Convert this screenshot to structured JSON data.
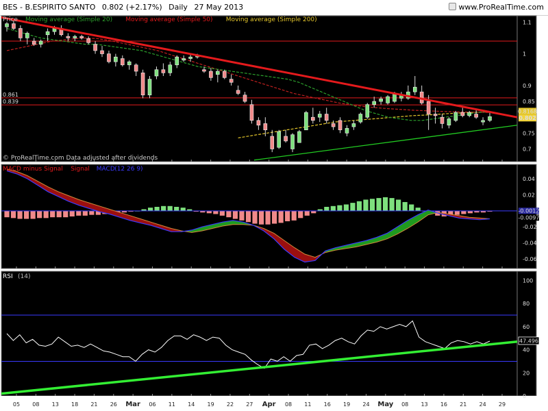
{
  "header": {
    "ticker": "BES - B.ESPIRITO SANTO",
    "price": "0.802 (+2.17%)",
    "period": "Daily",
    "date": "27 May 2013",
    "site": "www.ProRealTime.com"
  },
  "price_panel": {
    "legend": [
      {
        "text": "Price",
        "color": "#c8c8c8"
      },
      {
        "text": "Moving average (Simple 20)",
        "color": "#2ca02c"
      },
      {
        "text": "Moving average (Simple 50)",
        "color": "#e41a1c"
      },
      {
        "text": "Moving average (Simple 200)",
        "color": "#e6c82c"
      }
    ],
    "watermark": "© ProRealTime.com  Data adjusted after dividends",
    "level_labels": [
      {
        "text": "0.861",
        "value": 0.861
      },
      {
        "text": "0.839",
        "value": 0.839
      }
    ],
    "last_label_ma": "0.8168",
    "last_label_price": "0.802"
  },
  "macd_panel": {
    "legend": [
      {
        "text": "MACD minus Signal",
        "color": "#e41a1c"
      },
      {
        "text": "Signal",
        "color": "#e41a1c"
      },
      {
        "text": "MACD",
        "color": "#3a3aff"
      },
      {
        "text": "(12 26 9)",
        "color": "#3a3aff"
      }
    ],
    "last_label_top": "-0.0012",
    "last_label_bottom": "-0.0097"
  },
  "rsi_panel": {
    "legend": [
      {
        "text": "RSI",
        "color": "#ffffff"
      },
      {
        "text": "(14)",
        "color": "#bbbbbb"
      }
    ],
    "last_label": "47.496"
  },
  "chart_data": [
    {
      "type": "candlestick",
      "title": "BES - B.ESPIRITO SANTO",
      "ylim": [
        0.66,
        1.12
      ],
      "yticks": [
        0.7,
        0.75,
        0.8,
        0.85,
        0.9,
        1,
        1.1
      ],
      "ytick_labels": [
        "0.7",
        "0.75",
        "0.8",
        "0.85",
        "0.9",
        "1",
        "1.1"
      ],
      "x_ticks": [
        "05",
        "08",
        "13",
        "18",
        "21",
        "26",
        "Mar",
        "06",
        "11",
        "14",
        "19",
        "22",
        "27",
        "Apr",
        "08",
        "11",
        "16",
        "19",
        "24",
        "May",
        "08",
        "13",
        "16",
        "21",
        "24",
        "29"
      ],
      "ohlc": [
        [
          1.085,
          1.1,
          1.07,
          1.095
        ],
        [
          1.095,
          1.108,
          1.075,
          1.08
        ],
        [
          1.08,
          1.09,
          1.04,
          1.05
        ],
        [
          1.05,
          1.07,
          1.03,
          1.065
        ],
        [
          1.04,
          1.05,
          1.025,
          1.03
        ],
        [
          1.03,
          1.045,
          1.02,
          1.04
        ],
        [
          1.06,
          1.08,
          1.04,
          1.07
        ],
        [
          1.07,
          1.088,
          1.06,
          1.08
        ],
        [
          1.08,
          1.09,
          1.055,
          1.06
        ],
        [
          1.055,
          1.065,
          1.04,
          1.05
        ],
        [
          1.05,
          1.06,
          1.04,
          1.055
        ],
        [
          1.055,
          1.06,
          1.045,
          1.05
        ],
        [
          1.048,
          1.055,
          1.03,
          1.035
        ],
        [
          1.03,
          1.04,
          1.0,
          1.01
        ],
        [
          1.01,
          1.025,
          0.99,
          1.0
        ],
        [
          1.0,
          1.01,
          0.97,
          0.975
        ],
        [
          0.975,
          1.0,
          0.96,
          0.99
        ],
        [
          0.985,
          0.995,
          0.96,
          0.965
        ],
        [
          0.965,
          0.98,
          0.95,
          0.975
        ],
        [
          0.965,
          0.97,
          0.93,
          0.945
        ],
        [
          0.94,
          0.95,
          0.86,
          0.87
        ],
        [
          0.87,
          0.93,
          0.86,
          0.92
        ],
        [
          0.93,
          0.96,
          0.92,
          0.95
        ],
        [
          0.95,
          0.97,
          0.93,
          0.94
        ],
        [
          0.94,
          0.975,
          0.93,
          0.965
        ],
        [
          0.965,
          0.995,
          0.955,
          0.99
        ],
        [
          0.98,
          0.995,
          0.975,
          0.985
        ],
        [
          0.985,
          1.0,
          0.975,
          0.99
        ],
        [
          0.99,
          1.0,
          0.985,
          0.995
        ],
        [
          0.95,
          0.96,
          0.94,
          0.945
        ],
        [
          0.945,
          0.955,
          0.915,
          0.925
        ],
        [
          0.935,
          0.95,
          0.91,
          0.945
        ],
        [
          0.945,
          0.95,
          0.92,
          0.925
        ],
        [
          0.92,
          0.935,
          0.9,
          0.91
        ],
        [
          0.885,
          0.9,
          0.87,
          0.875
        ],
        [
          0.87,
          0.88,
          0.845,
          0.85
        ],
        [
          0.84,
          0.855,
          0.78,
          0.79
        ],
        [
          0.79,
          0.8,
          0.76,
          0.775
        ],
        [
          0.78,
          0.8,
          0.74,
          0.76
        ],
        [
          0.74,
          0.76,
          0.69,
          0.7
        ],
        [
          0.705,
          0.76,
          0.7,
          0.755
        ],
        [
          0.74,
          0.76,
          0.72,
          0.725
        ],
        [
          0.7,
          0.75,
          0.69,
          0.745
        ],
        [
          0.72,
          0.76,
          0.72,
          0.755
        ],
        [
          0.76,
          0.82,
          0.76,
          0.815
        ],
        [
          0.8,
          0.83,
          0.78,
          0.79
        ],
        [
          0.8,
          0.82,
          0.785,
          0.81
        ],
        [
          0.81,
          0.83,
          0.78,
          0.79
        ],
        [
          0.78,
          0.79,
          0.76,
          0.77
        ],
        [
          0.79,
          0.8,
          0.75,
          0.76
        ],
        [
          0.75,
          0.775,
          0.74,
          0.765
        ],
        [
          0.77,
          0.79,
          0.76,
          0.78
        ],
        [
          0.785,
          0.815,
          0.78,
          0.81
        ],
        [
          0.8,
          0.845,
          0.795,
          0.84
        ],
        [
          0.84,
          0.865,
          0.83,
          0.85
        ],
        [
          0.85,
          0.865,
          0.84,
          0.858
        ],
        [
          0.845,
          0.87,
          0.84,
          0.865
        ],
        [
          0.85,
          0.88,
          0.845,
          0.875
        ],
        [
          0.86,
          0.88,
          0.85,
          0.87
        ],
        [
          0.86,
          0.9,
          0.855,
          0.88
        ],
        [
          0.88,
          0.93,
          0.87,
          0.895
        ],
        [
          0.88,
          0.9,
          0.84,
          0.845
        ],
        [
          0.85,
          0.87,
          0.76,
          0.81
        ],
        [
          0.81,
          0.83,
          0.78,
          0.805
        ],
        [
          0.8,
          0.81,
          0.765,
          0.78
        ],
        [
          0.775,
          0.8,
          0.765,
          0.795
        ],
        [
          0.79,
          0.82,
          0.785,
          0.815
        ],
        [
          0.815,
          0.83,
          0.8,
          0.805
        ],
        [
          0.805,
          0.82,
          0.8,
          0.815
        ],
        [
          0.81,
          0.825,
          0.795,
          0.8
        ],
        [
          0.785,
          0.8,
          0.775,
          0.79
        ],
        [
          0.79,
          0.815,
          0.785,
          0.802
        ]
      ],
      "ma20": [
        1.08,
        1.07,
        1.06,
        1.05,
        1.045,
        1.04,
        1.035,
        1.03,
        1.03,
        1.025,
        1.02,
        1.015,
        1.01,
        1.0,
        0.99,
        0.98,
        0.97,
        0.96,
        0.955,
        0.95,
        0.945,
        0.94,
        0.935,
        0.93,
        0.925,
        0.92,
        0.91,
        0.895,
        0.88,
        0.865,
        0.85,
        0.835,
        0.82,
        0.81,
        0.8,
        0.795,
        0.79,
        0.79,
        0.795,
        0.8,
        0.805,
        0.81,
        0.815,
        0.818
      ],
      "ma50": [
        1.01,
        1.02,
        1.03,
        1.04,
        1.045,
        1.05,
        1.048,
        1.04,
        1.03,
        1.02,
        1.01,
        0.995,
        0.98,
        0.965,
        0.95,
        0.935,
        0.92,
        0.905,
        0.89,
        0.875,
        0.865,
        0.855,
        0.845,
        0.838,
        0.832,
        0.828,
        0.825,
        0.822,
        0.82,
        0.818,
        0.817,
        0.816,
        0.815
      ],
      "ma200": [
        0.735,
        0.745,
        0.755,
        0.765,
        0.775,
        0.785,
        0.79,
        0.795,
        0.8,
        0.805,
        0.808,
        0.812,
        0.815,
        0.817
      ],
      "trendlines": [
        {
          "from": [
            0,
            1.115
          ],
          "to": [
            1,
            0.8
          ],
          "color": "#e41a1c"
        },
        {
          "from": [
            0.49,
            0.665
          ],
          "to": [
            1,
            0.775
          ],
          "color": "#22cc22"
        }
      ],
      "horizontal_levels": [
        0.861,
        0.839,
        1.04
      ]
    },
    {
      "type": "bar",
      "title": "MACD minus Signal",
      "ylim": [
        -0.072,
        0.058
      ],
      "yticks": [
        0.04,
        0.02,
        0,
        -0.02,
        -0.04,
        -0.06
      ],
      "ytick_labels": [
        "0.04",
        "0.02",
        "0",
        "-0.02",
        "-0.04",
        "-0.06"
      ],
      "histogram": [
        -0.008,
        -0.009,
        -0.01,
        -0.01,
        -0.01,
        -0.009,
        -0.009,
        -0.008,
        -0.008,
        -0.008,
        -0.007,
        -0.006,
        -0.006,
        -0.005,
        -0.005,
        -0.004,
        -0.004,
        -0.003,
        -0.002,
        -0.001,
        0.0,
        0.002,
        0.004,
        0.005,
        0.006,
        0.006,
        0.005,
        0.004,
        0.002,
        -0.001,
        -0.002,
        -0.003,
        -0.004,
        -0.006,
        -0.008,
        -0.01,
        -0.012,
        -0.014,
        -0.016,
        -0.017,
        -0.017,
        -0.016,
        -0.015,
        -0.013,
        -0.012,
        -0.009,
        -0.006,
        -0.003,
        0.002,
        0.005,
        0.006,
        0.007,
        0.008,
        0.01,
        0.012,
        0.014,
        0.015,
        0.016,
        0.017,
        0.016,
        0.014,
        0.011,
        0.008,
        0.004,
        0.0,
        -0.003,
        -0.006,
        -0.007,
        -0.006,
        -0.005,
        -0.004,
        -0.003,
        -0.002,
        -0.002,
        -0.001
      ],
      "macd": [
        0.05,
        0.046,
        0.04,
        0.032,
        0.024,
        0.018,
        0.012,
        0.007,
        0.003,
        -0.001,
        -0.004,
        -0.008,
        -0.012,
        -0.015,
        -0.018,
        -0.022,
        -0.026,
        -0.026,
        -0.024,
        -0.02,
        -0.017,
        -0.014,
        -0.012,
        -0.014,
        -0.018,
        -0.025,
        -0.035,
        -0.048,
        -0.058,
        -0.064,
        -0.062,
        -0.05,
        -0.046,
        -0.043,
        -0.04,
        -0.037,
        -0.033,
        -0.028,
        -0.02,
        -0.012,
        -0.005,
        0.001,
        -0.003,
        -0.006,
        -0.009,
        -0.01,
        -0.011,
        -0.01
      ],
      "signal": [
        0.052,
        0.049,
        0.044,
        0.037,
        0.03,
        0.024,
        0.019,
        0.014,
        0.01,
        0.006,
        0.002,
        -0.002,
        -0.006,
        -0.01,
        -0.014,
        -0.018,
        -0.022,
        -0.025,
        -0.027,
        -0.025,
        -0.022,
        -0.019,
        -0.017,
        -0.017,
        -0.018,
        -0.022,
        -0.028,
        -0.037,
        -0.046,
        -0.054,
        -0.058,
        -0.052,
        -0.049,
        -0.047,
        -0.045,
        -0.042,
        -0.039,
        -0.035,
        -0.029,
        -0.022,
        -0.014,
        -0.005,
        -0.002,
        -0.004,
        -0.006,
        -0.008,
        -0.009,
        -0.01
      ],
      "zero_line": 0
    },
    {
      "type": "line",
      "title": "RSI",
      "ylim": [
        0,
        108
      ],
      "yticks": [
        100,
        80,
        60,
        40,
        20,
        0
      ],
      "ytick_labels": [
        "100",
        "80",
        "60",
        "40",
        "20",
        "0"
      ],
      "levels": [
        70,
        30
      ],
      "rsi": [
        54,
        48,
        53,
        46,
        49,
        44,
        43,
        45,
        51,
        47,
        43,
        44,
        42,
        45,
        42,
        39,
        38,
        36,
        34,
        34,
        30,
        36,
        40,
        38,
        42,
        48,
        52,
        52,
        49,
        53,
        51,
        48,
        51,
        50,
        44,
        40,
        38,
        36,
        31,
        27,
        24,
        32,
        30,
        34,
        30,
        35,
        36,
        44,
        45,
        41,
        44,
        48,
        50,
        47,
        45,
        52,
        57,
        56,
        60,
        58,
        60,
        62,
        60,
        65,
        51,
        47,
        45,
        43,
        41,
        46,
        48,
        47,
        45,
        47,
        45,
        47.5
      ],
      "trendline": {
        "from": [
          0,
          2
        ],
        "to": [
          1,
          47
        ]
      }
    }
  ]
}
